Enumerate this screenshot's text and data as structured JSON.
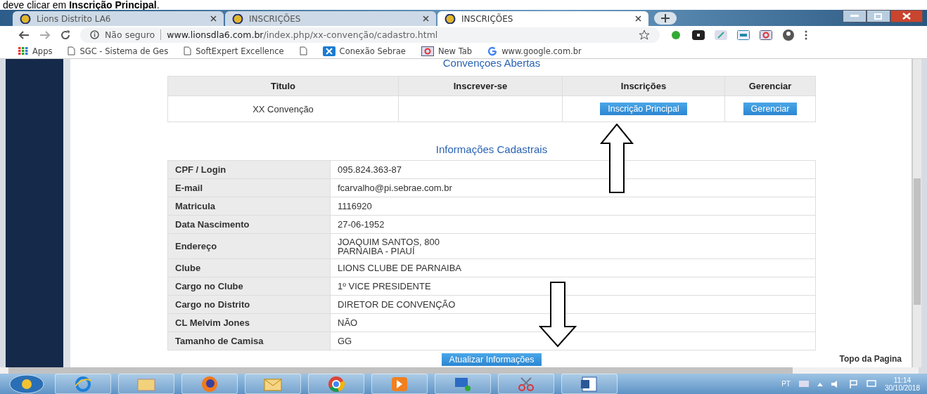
{
  "document_text": "deve clicar em **Inscrição Principal**.",
  "browser": {
    "tabs": [
      {
        "title": "Lions Distrito LA6",
        "selected": false
      },
      {
        "title": "INSCRIÇÕES",
        "selected": false
      },
      {
        "title": "INSCRIÇÕES",
        "selected": true
      }
    ],
    "security": "Não seguro",
    "url_host": "www.lionsdla6.com.br",
    "url_path": "/index.php/xx-convenção/cadastro.html",
    "bookmarks": [
      {
        "kind": "apps",
        "label": "Apps"
      },
      {
        "kind": "page",
        "label": "SGC - Sistema de Ges"
      },
      {
        "kind": "page",
        "label": "SoftExpert Excellence"
      },
      {
        "kind": "page"
      },
      {
        "kind": "x",
        "label": "Conexão Sebrae"
      },
      {
        "kind": "newtab",
        "label": "New Tab"
      },
      {
        "kind": "google",
        "label": "www.google.com.br"
      }
    ]
  },
  "page": {
    "section_title": "Convençoes Abertas",
    "conventions": {
      "columns": [
        "Titulo",
        "Inscrever-se",
        "Inscrições",
        "Gerenciar"
      ],
      "rows": [
        {
          "title": "XX Convenção",
          "primary_button": "Inscrição Principal",
          "manage_button": "Gerenciar"
        }
      ]
    },
    "info_title": "Informações Cadastrais",
    "info": [
      {
        "label": "CPF / Login",
        "lines": [
          "095.824.363-87"
        ]
      },
      {
        "label": "E-mail",
        "lines": [
          "fcarvalho@pi.sebrae.com.br"
        ]
      },
      {
        "label": "Matricula",
        "lines": [
          "1116920"
        ]
      },
      {
        "label": "Data Nascimento",
        "lines": [
          "27-06-1952"
        ]
      },
      {
        "label": "Endereço",
        "lines": [
          "JOAQUIM SANTOS, 800",
          "PARNAIBA - PIAUÍ"
        ]
      },
      {
        "label": "Clube",
        "lines": [
          "LIONS CLUBE DE PARNAIBA"
        ]
      },
      {
        "label": "Cargo no Clube",
        "lines": [
          "1º VICE PRESIDENTE"
        ]
      },
      {
        "label": "Cargo no Distrito",
        "lines": [
          "DIRETOR DE CONVENÇÃO"
        ]
      },
      {
        "label": "CL Melvim Jones",
        "lines": [
          "NÃO"
        ]
      },
      {
        "label": "Tamanho de Camisa",
        "lines": [
          "GG"
        ]
      }
    ],
    "update_button": "Atualizar Informações",
    "top_link": "Topo da Pagina",
    "annotations": [
      {
        "kind": "up"
      },
      {
        "kind": "down"
      }
    ]
  },
  "taskbar": {
    "apps": [
      {
        "kind": "ie"
      },
      {
        "kind": "folder"
      },
      {
        "kind": "firefox"
      },
      {
        "kind": "mail"
      },
      {
        "kind": "chrome"
      },
      {
        "kind": "media"
      },
      {
        "kind": "network"
      },
      {
        "kind": "scissors"
      },
      {
        "kind": "word"
      }
    ],
    "language": "PT",
    "time": "11:14",
    "date": "30/10/2018"
  }
}
